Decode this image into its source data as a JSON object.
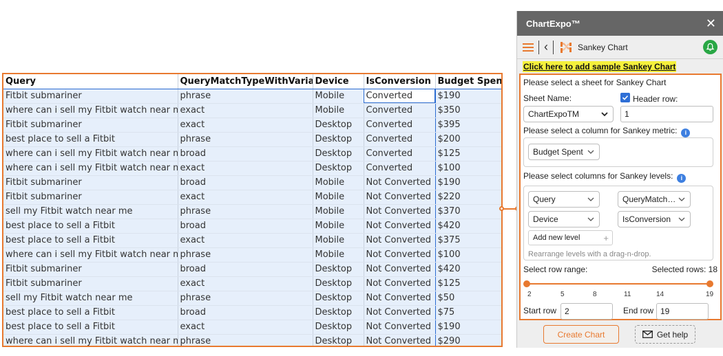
{
  "sheet": {
    "headers": [
      "Query",
      "QueryMatchTypeWithVariant",
      "Device",
      "IsConversion",
      "Budget Spent"
    ],
    "rows": [
      [
        "Fitbit submariner",
        "phrase",
        "Mobile",
        "Converted",
        "$190"
      ],
      [
        "where can i sell my Fitbit watch near me",
        "exact",
        "Mobile",
        "Converted",
        "$350"
      ],
      [
        "Fitbit submariner",
        "exact",
        "Desktop",
        "Converted",
        "$395"
      ],
      [
        "best place to sell a Fitbit",
        "phrase",
        "Desktop",
        "Converted",
        "$200"
      ],
      [
        "where can i sell my Fitbit watch near me",
        "broad",
        "Desktop",
        "Converted",
        "$125"
      ],
      [
        "where can i sell my Fitbit watch near me",
        "exact",
        "Desktop",
        "Converted",
        "$100"
      ],
      [
        "Fitbit submariner",
        "broad",
        "Mobile",
        "Not Converted",
        "$190"
      ],
      [
        "Fitbit submariner",
        "exact",
        "Mobile",
        "Not Converted",
        "$220"
      ],
      [
        "sell my Fitbit watch near me",
        "phrase",
        "Mobile",
        "Not Converted",
        "$370"
      ],
      [
        "best place to sell a Fitbit",
        "broad",
        "Mobile",
        "Not Converted",
        "$420"
      ],
      [
        "best place to sell a Fitbit",
        "exact",
        "Mobile",
        "Not Converted",
        "$375"
      ],
      [
        "where can i sell my Fitbit watch near me",
        "phrase",
        "Mobile",
        "Not Converted",
        "$100"
      ],
      [
        "Fitbit submariner",
        "broad",
        "Desktop",
        "Not Converted",
        "$420"
      ],
      [
        "Fitbit submariner",
        "exact",
        "Desktop",
        "Not Converted",
        "$125"
      ],
      [
        "sell my Fitbit watch near me",
        "phrase",
        "Desktop",
        "Not Converted",
        "$50"
      ],
      [
        "best place to sell a Fitbit",
        "broad",
        "Desktop",
        "Not Converted",
        "$75"
      ],
      [
        "best place to sell a Fitbit",
        "exact",
        "Desktop",
        "Not Converted",
        "$190"
      ],
      [
        "where can i sell my Fitbit watch near me",
        "phrase",
        "Desktop",
        "Not Converted",
        "$290"
      ]
    ]
  },
  "panel": {
    "title": "ChartExpo™",
    "close_glyph": "✕",
    "back_glyph": "‹",
    "chart_name": "Sankey Chart",
    "sample_link": "Click here to add sample Sankey Chart",
    "select_sheet_prompt": "Please select a sheet for Sankey Chart",
    "sheet_name_label": "Sheet Name:",
    "header_row_label": "Header row:",
    "sheet_name_value": "ChartExpoTM",
    "header_row_value": "1",
    "metric_prompt": "Please select a column for Sankey metric:",
    "metric_value": "Budget Spent",
    "levels_prompt": "Please select columns for Sankey levels:",
    "levels": [
      "Query",
      "QueryMatchT...",
      "Device",
      "IsConversion"
    ],
    "add_level_label": "Add new level",
    "add_level_plus": "+",
    "rearrange_hint": "Rearrange levels with a drag-n-drop.",
    "row_range_label": "Select row range:",
    "selected_rows_label": "Selected rows: 18",
    "range_ticks": [
      "2",
      "5",
      "8",
      "11",
      "14",
      "19"
    ],
    "range_start": 2,
    "range_end": 19,
    "start_row_label": "Start row",
    "start_row_value": "2",
    "end_row_label": "End row",
    "end_row_value": "19",
    "create_button": "Create Chart",
    "help_button": "Get help",
    "info_glyph": "i"
  },
  "colors": {
    "accent": "#e8792f",
    "header_bar": "#666666",
    "selection_blue": "#2a6bd1",
    "row_fill": "#e6effb",
    "bell_green": "#29a745",
    "link_highlight": "#f5f03c"
  },
  "icons": [
    "hamburger-menu-icon",
    "back-icon",
    "sankey-chart-icon",
    "bell-icon",
    "close-icon",
    "info-icon",
    "chevron-down-icon",
    "checkmark-icon",
    "mail-icon",
    "plus-icon"
  ]
}
